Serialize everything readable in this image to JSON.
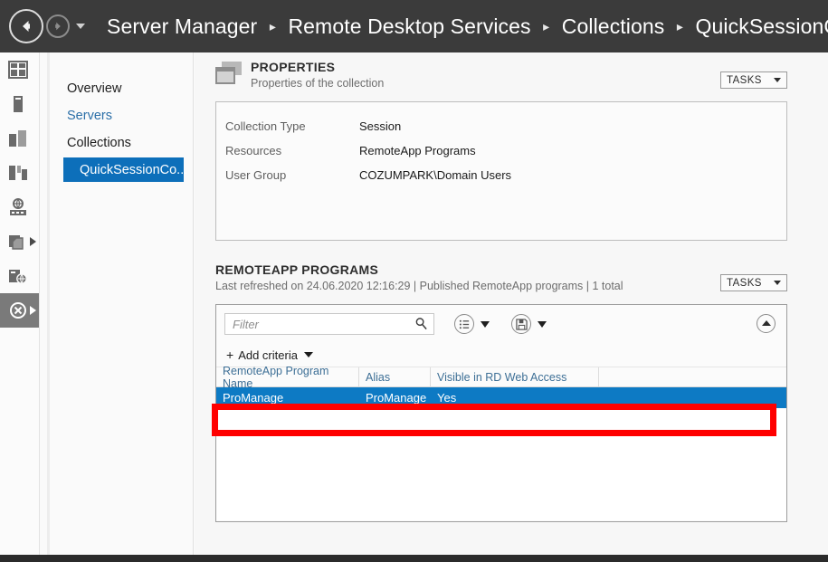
{
  "titlebar": {
    "back_icon": "back-arrow-icon",
    "forward_icon": "forward-arrow-icon",
    "dropdown_icon": "chevron-down-icon",
    "breadcrumb": [
      "Server Manager",
      "Remote Desktop Services",
      "Collections",
      "QuickSessionColle"
    ],
    "separator": "▸"
  },
  "icon_rail": {
    "items": [
      {
        "name": "dashboard-icon",
        "expandable": false,
        "selected": false
      },
      {
        "name": "local-server-icon",
        "expandable": false,
        "selected": false
      },
      {
        "name": "all-servers-icon",
        "expandable": false,
        "selected": false
      },
      {
        "name": "file-storage-services-icon",
        "expandable": false,
        "selected": false
      },
      {
        "name": "iis-icon",
        "expandable": false,
        "selected": false
      },
      {
        "name": "remote-access-icon",
        "expandable": true,
        "selected": false
      },
      {
        "name": "rds-overview-icon",
        "expandable": false,
        "selected": false
      },
      {
        "name": "remote-desktop-services-icon",
        "expandable": true,
        "selected": true
      }
    ]
  },
  "tree_nav": {
    "items": [
      {
        "label": "Overview",
        "style": "normal"
      },
      {
        "label": "Servers",
        "style": "link"
      },
      {
        "label": "Collections",
        "style": "normal"
      },
      {
        "label": "QuickSessionCo...",
        "style": "selected"
      }
    ]
  },
  "properties_section": {
    "icon": "properties-window-icon",
    "title": "PROPERTIES",
    "subtitle": "Properties of the collection",
    "tasks_label": "TASKS",
    "tasks_caret_icon": "caret-down-icon",
    "rows": [
      {
        "key": "Collection Type",
        "value": "Session"
      },
      {
        "key": "Resources",
        "value": "RemoteApp Programs"
      },
      {
        "key": "User Group",
        "value": "COZUMPARK\\Domain Users"
      }
    ]
  },
  "remoteapp_section": {
    "title": "REMOTEAPP PROGRAMS",
    "subtitle": "Last refreshed on 24.06.2020 12:16:29 | Published RemoteApp programs  | 1 total",
    "tasks_label": "TASKS",
    "tasks_caret_icon": "caret-down-icon",
    "filter": {
      "placeholder": "Filter",
      "search_icon": "search-icon",
      "query_button_icon": "query-list-icon",
      "save_button_icon": "save-floppy-icon",
      "collapse_icon": "chevron-up-icon"
    },
    "add_criteria": {
      "plus_icon": "plus-icon",
      "label": "Add criteria",
      "caret_icon": "caret-down-icon"
    },
    "columns": [
      "RemoteApp Program Name",
      "Alias",
      "Visible in RD Web Access"
    ],
    "rows": [
      {
        "program_name": "ProManage",
        "alias": "ProManage",
        "visible": "Yes",
        "selected": true
      }
    ]
  },
  "annotation": {
    "type": "red-highlight-box",
    "color": "#ff0000",
    "target": "remoteapp-program-row-promanage"
  },
  "colors": {
    "titlebar_bg": "#3b3b3b",
    "selection_blue": "#0d7ac4",
    "tree_selection_blue": "#0d6fba",
    "link_blue": "#2b6fa8",
    "column_header_blue": "#3d6f96",
    "annotation_red": "#ff0000",
    "rail_selected_bg": "#7a7a7a"
  }
}
